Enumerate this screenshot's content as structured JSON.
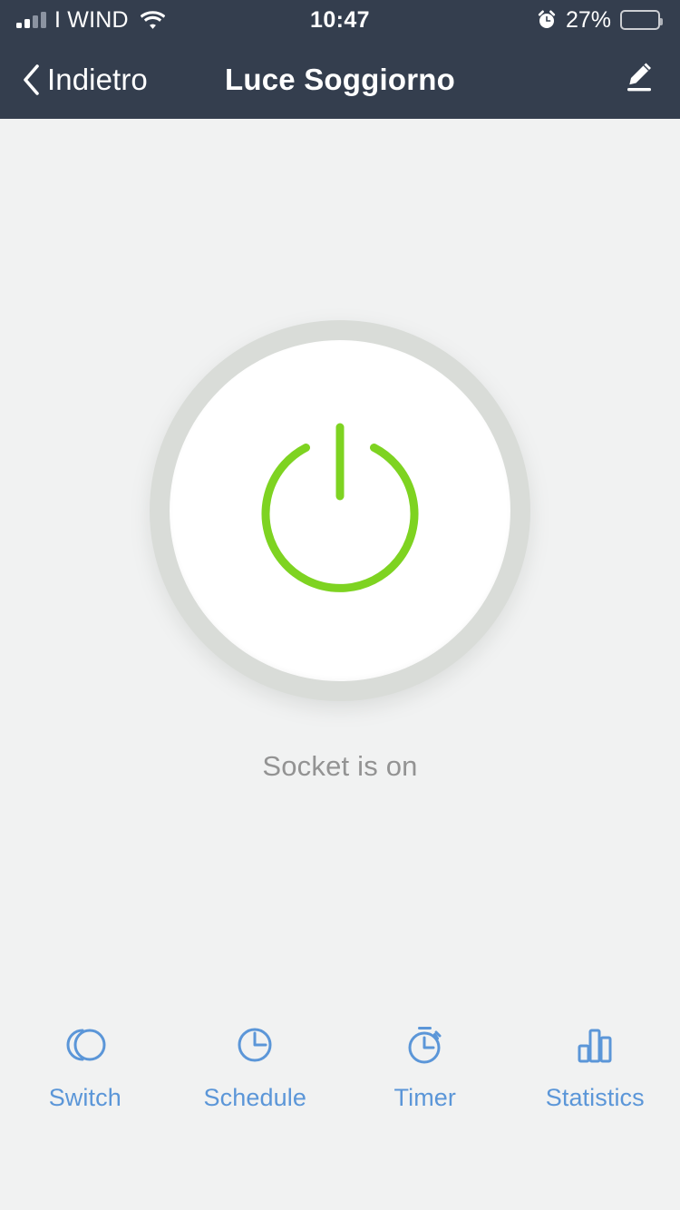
{
  "status_bar": {
    "carrier": "I WIND",
    "time": "10:47",
    "battery_percent": "27%",
    "battery_level": 27,
    "icons": {
      "signal": "signal-bars-icon",
      "wifi": "wifi-icon",
      "alarm": "alarm-clock-icon",
      "battery": "battery-icon"
    }
  },
  "nav_bar": {
    "back_label": "Indietro",
    "title": "Luce Soggiorno",
    "back_icon": "chevron-left-icon",
    "edit_icon": "pencil-edit-icon"
  },
  "main": {
    "power_button": {
      "icon": "power-icon",
      "state": "on",
      "accent_color": "#7ed321"
    },
    "status_text": "Socket is on"
  },
  "tab_bar": {
    "tabs": [
      {
        "label": "Switch",
        "icon": "switch-toggle-icon"
      },
      {
        "label": "Schedule",
        "icon": "clock-icon"
      },
      {
        "label": "Timer",
        "icon": "stopwatch-icon"
      },
      {
        "label": "Statistics",
        "icon": "bar-chart-icon"
      }
    ]
  },
  "colors": {
    "header_bg": "#343e4e",
    "page_bg": "#f1f2f2",
    "accent_green": "#7ed321",
    "tab_blue": "#5b96d8",
    "ring_gray": "#d9dcd8",
    "status_text_gray": "#939393"
  }
}
